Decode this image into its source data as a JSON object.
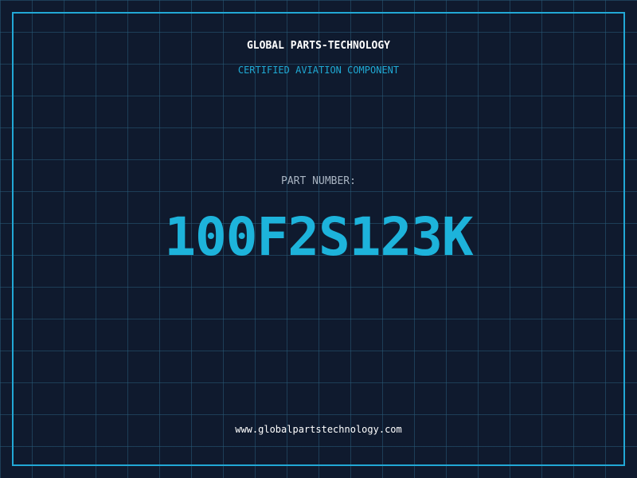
{
  "header": {
    "company": "GLOBAL PARTS-TECHNOLOGY",
    "subtitle": "CERTIFIED AVIATION COMPONENT"
  },
  "part": {
    "label": "PART NUMBER:",
    "number": "100F2S123K"
  },
  "footer": {
    "website": "www.globalpartstechnology.com"
  },
  "colors": {
    "background": "#0f1a2e",
    "grid": "#285a78",
    "accent": "#1db3db",
    "frame": "#22a8d6",
    "label": "#a9b4c2"
  }
}
